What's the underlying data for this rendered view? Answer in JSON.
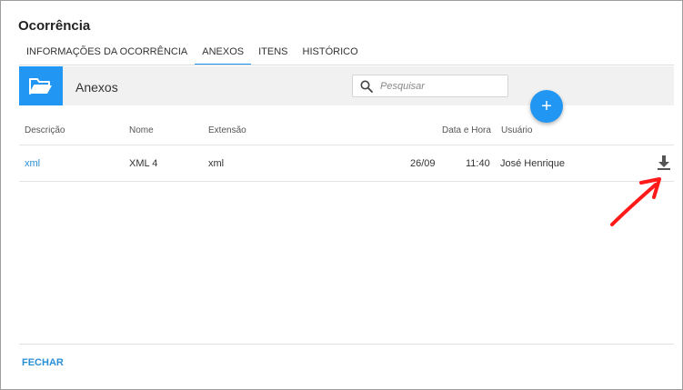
{
  "dialog": {
    "title": "Ocorrência"
  },
  "tabs": [
    {
      "label": "INFORMAÇÕES DA OCORRÊNCIA"
    },
    {
      "label": "ANEXOS",
      "active": true
    },
    {
      "label": "ITENS"
    },
    {
      "label": "HISTÓRICO"
    }
  ],
  "section": {
    "title": "Anexos",
    "icon": "folder-open-icon"
  },
  "search": {
    "placeholder": "Pesquisar",
    "value": ""
  },
  "add_button": {
    "label": "+"
  },
  "table": {
    "columns": [
      "Descrição",
      "Nome",
      "Extensão",
      "Data e Hora",
      "Usuário"
    ],
    "rows": [
      {
        "descricao": "xml",
        "nome": "XML 4",
        "extensao": "xml",
        "data": "26/09",
        "hora": "11:40",
        "usuario": "José Henrique"
      }
    ]
  },
  "footer": {
    "close_label": "FECHAR"
  },
  "colors": {
    "accent": "#2196f3",
    "link": "#2b8fd6",
    "annotation": "#ff0000"
  }
}
